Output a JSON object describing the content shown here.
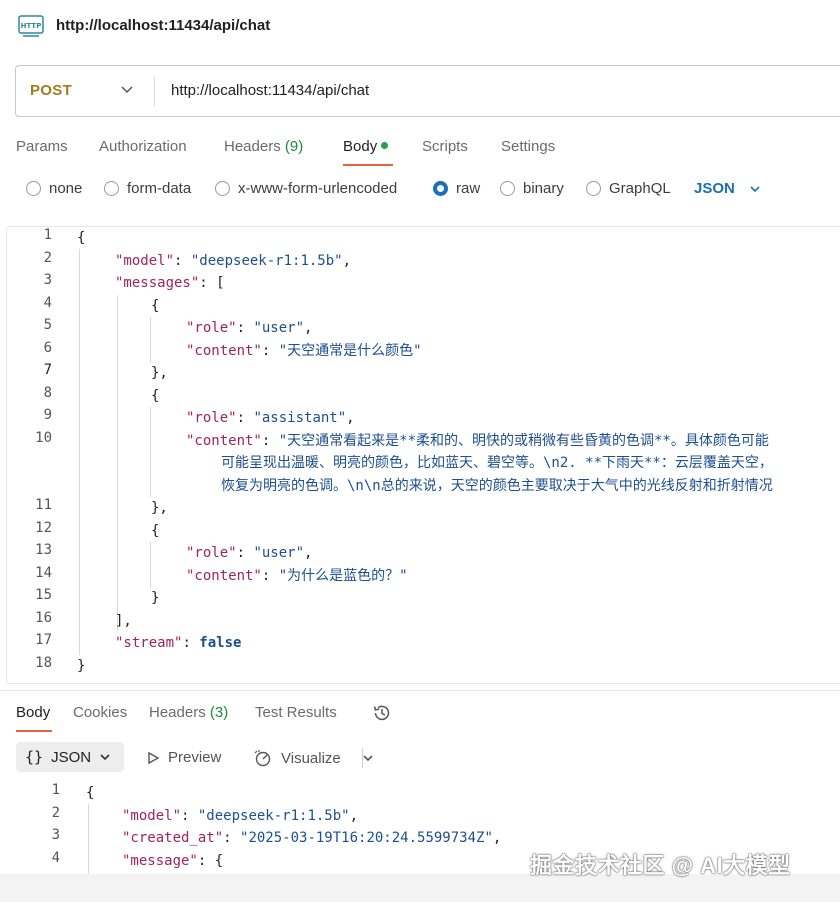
{
  "window": {
    "title": "http://localhost:11434/api/chat",
    "icon": "http-icon"
  },
  "request": {
    "method": "POST",
    "url": "http://localhost:11434/api/chat"
  },
  "request_tabs": {
    "params": "Params",
    "authorization": "Authorization",
    "headers": "Headers",
    "headers_count": "(9)",
    "body": "Body",
    "scripts": "Scripts",
    "settings": "Settings"
  },
  "body_types": {
    "none": "none",
    "form_data": "form-data",
    "urlencoded": "x-www-form-urlencoded",
    "raw": "raw",
    "binary": "binary",
    "graphql": "GraphQL",
    "selected": "raw",
    "language": "JSON"
  },
  "editor": {
    "line_numbers": [
      "1",
      "2",
      "3",
      "4",
      "5",
      "6",
      "7",
      "8",
      "9",
      "10",
      "11",
      "12",
      "13",
      "14",
      "15",
      "16",
      "17",
      "18"
    ],
    "lines": {
      "l1": "{",
      "l2_key": "\"model\"",
      "l2_val": "\"deepseek-r1:1.5b\"",
      "l3_key": "\"messages\"",
      "l3_rest": "[",
      "l4": "{",
      "l5_key": "\"role\"",
      "l5_val": "\"user\"",
      "l6_key": "\"content\"",
      "l6_val": "\"天空通常是什么颜色\"",
      "l7": "},",
      "l8": "{",
      "l9_key": "\"role\"",
      "l9_val": "\"assistant\"",
      "l10_key": "\"content\"",
      "l10_val_1": "\"天空通常看起来是**柔和的、明快的或稍微有些昏黄的色调**。具体颜色可能",
      "l10_val_2": "可能呈现出温暖、明亮的颜色，比如蓝天、碧空等。\\n2. **下雨天**：云层覆盖天空，",
      "l10_val_3": "恢复为明亮的色调。\\n\\n总的来说，天空的颜色主要取决于大气中的光线反射和折射情况",
      "l11": "},",
      "l12": "{",
      "l13_key": "\"role\"",
      "l13_val": "\"user\"",
      "l14_key": "\"content\"",
      "l14_val": "\"为什么是蓝色的？\"",
      "l15": "}",
      "l16": "],",
      "l17_key": "\"stream\"",
      "l17_val": "false",
      "l18": "}"
    }
  },
  "response_tabs": {
    "body": "Body",
    "cookies": "Cookies",
    "headers": "Headers",
    "headers_count": "(3)",
    "test_results": "Test Results"
  },
  "response_toolbar": {
    "format_braces": "{}",
    "format": "JSON",
    "preview": "Preview",
    "visualize": "Visualize"
  },
  "response": {
    "line_numbers": [
      "1",
      "2",
      "3",
      "4"
    ],
    "l1": "{",
    "l2_key": "\"model\"",
    "l2_val": "\"deepseek-r1:1.5b\"",
    "l3_key": "\"created_at\"",
    "l3_val": "\"2025-03-19T16:20:24.5599734Z\"",
    "l4_key": "\"message\"",
    "l4_rest": "{"
  },
  "watermark": "掘金技术社区 @ AI大模型",
  "colors": {
    "method": "#a37b1b",
    "accent": "#e8633a",
    "selected": "#1b6fb8",
    "json_key": "#a0235c",
    "json_string": "#1c4f8f",
    "count": "#1e8a3a"
  }
}
